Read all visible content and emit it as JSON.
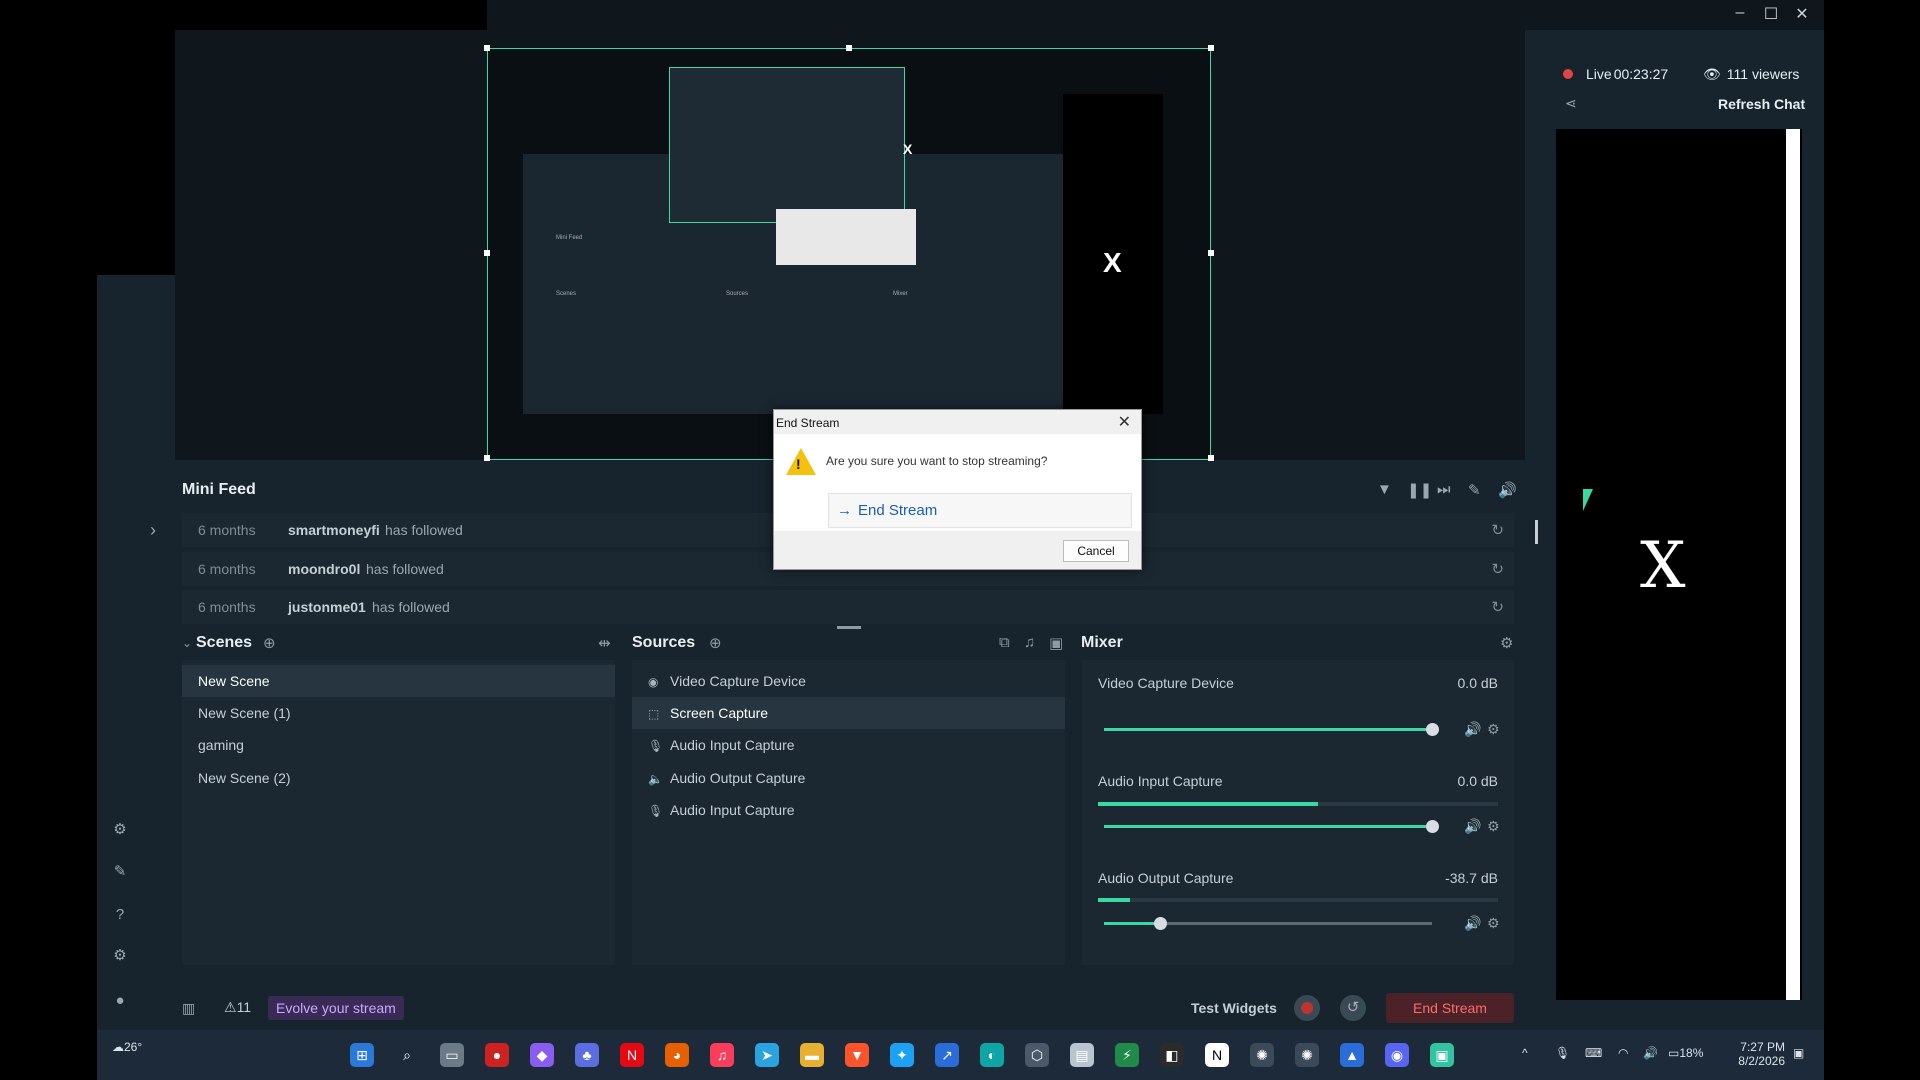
{
  "window_controls": {
    "minimize": "–",
    "maximize": "☐",
    "close": "✕"
  },
  "preview": {
    "mini_x_label": "X",
    "nested_x_label": "X"
  },
  "mini_feed": {
    "title": "Mini Feed",
    "items": [
      {
        "time": "6 months",
        "user": "smartmoneyfi",
        "action": "has followed"
      },
      {
        "time": "6 months",
        "user": "moondro0l",
        "action": "has followed"
      },
      {
        "time": "6 months",
        "user": "justonme01",
        "action": "has followed"
      }
    ]
  },
  "scenes": {
    "title": "Scenes",
    "items": [
      "New Scene",
      "New Scene (1)",
      "gaming",
      "New Scene (2)"
    ],
    "selected_index": 0
  },
  "sources": {
    "title": "Sources",
    "items": [
      {
        "label": "Video Capture Device",
        "icon": "camera-icon"
      },
      {
        "label": "Screen Capture",
        "icon": "screen-icon"
      },
      {
        "label": "Audio Input Capture",
        "icon": "microphone-icon"
      },
      {
        "label": "Audio Output Capture",
        "icon": "speaker-icon"
      },
      {
        "label": "Audio Input Capture",
        "icon": "microphone-icon"
      }
    ],
    "selected_index": 1
  },
  "mixer": {
    "title": "Mixer",
    "channels": [
      {
        "name": "Video Capture Device",
        "db": "0.0 dB",
        "meter_level": 0.0,
        "slider_level": 1.0
      },
      {
        "name": "Audio Input Capture",
        "db": "0.0 dB",
        "meter_level": 0.55,
        "slider_level": 1.0
      },
      {
        "name": "Audio Output Capture",
        "db": "-38.7 dB",
        "meter_level": 0.08,
        "slider_level": 0.17
      }
    ]
  },
  "footer": {
    "alerts_count": "11",
    "evolve_label": "Evolve your stream",
    "test_widgets_label": "Test Widgets",
    "end_stream_label": "End Stream"
  },
  "chat": {
    "live_label": "Live",
    "live_time": "00:23:27",
    "viewers": "111 viewers",
    "refresh_label": "Refresh Chat",
    "x_label": "X"
  },
  "dialog": {
    "title": "End Stream",
    "message": "Are you sure you want to stop streaming?",
    "command_label": "End Stream",
    "cancel_label": "Cancel"
  },
  "taskbar": {
    "weather": "26°",
    "battery": "18%",
    "time": "7:27 PM",
    "date": "8/2/2026"
  },
  "colors": {
    "accent": "#3ad8a5",
    "panel_bg": "#1b2831",
    "app_bg": "#17242d",
    "danger": "#ff6a6a"
  }
}
